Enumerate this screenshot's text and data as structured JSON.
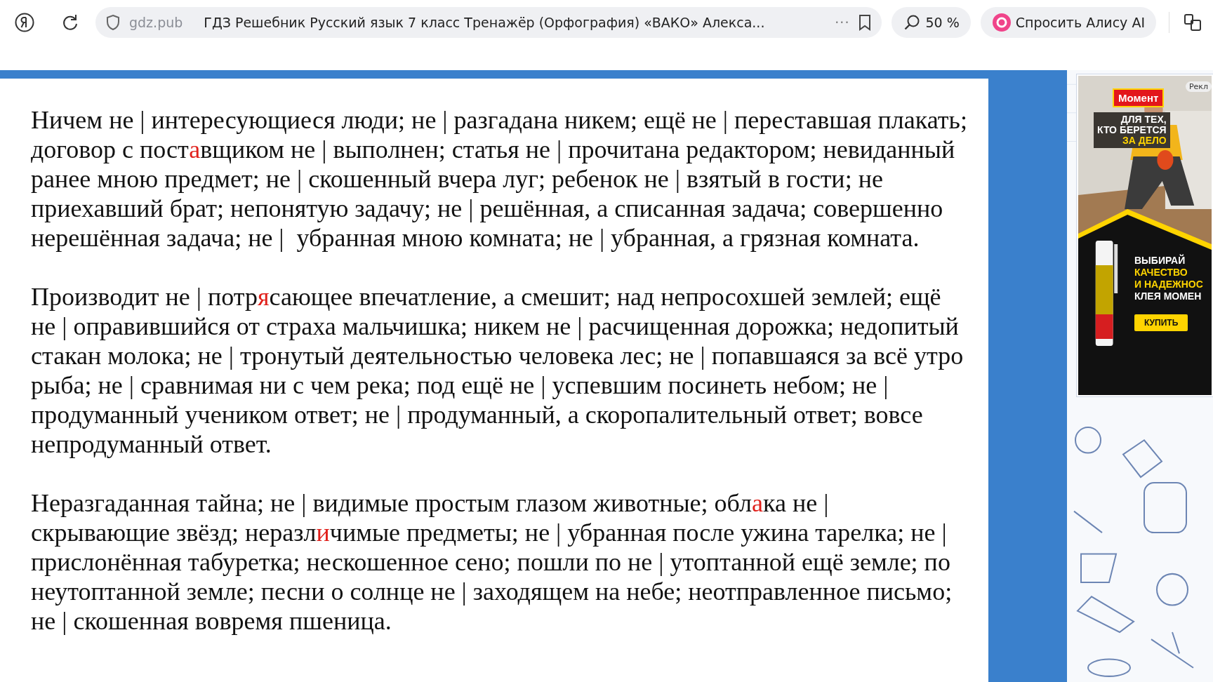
{
  "browser": {
    "site": "gdz.pub",
    "title": "ГДЗ Решебник Русский язык 7 класс Тренажёр (Орфография) «ВАКО» Алекса...",
    "menu": "···",
    "zoom": "50 %",
    "assistant": "Спросить Алису AI"
  },
  "exercises": [
    {
      "lines": [
        [
          {
            "text": "Ничем не | интересующиеся люди; не | разгадана никем; ещё не | переставшая плакать;",
            "highlighted": false
          }
        ],
        [
          {
            "text": "договор с пост",
            "highlighted": false
          },
          {
            "text": "а",
            "highlighted": true
          },
          {
            "text": "вщиком не | выполнен; статья не | прочитана редактором; невиданный",
            "highlighted": false
          }
        ],
        [
          {
            "text": "ранее мною предмет; не | скошенный вчера луг; ребенок не | взятый в гости; не",
            "highlighted": false
          }
        ],
        [
          {
            "text": "приехавший брат; непонятую задачу; не | решённая, а списанная задача; совершенно",
            "highlighted": false
          }
        ],
        [
          {
            "text": "нерешённая задача; не |  убранная мною комната; не | убранная, а грязная комната.",
            "highlighted": false
          }
        ]
      ]
    },
    {
      "lines": [
        [
          {
            "text": "Производит не | потр",
            "highlighted": false
          },
          {
            "text": "я",
            "highlighted": true
          },
          {
            "text": "сающее впечатление, а смешит; над непросохшей землей; ещё",
            "highlighted": false
          }
        ],
        [
          {
            "text": "не | оправившийся от страха мальчишка; никем не | расчищенная дорожка; недопитый",
            "highlighted": false
          }
        ],
        [
          {
            "text": "стакан молока; не | тронутый деятельностью человека лес; не | попавшаяся за всё утро",
            "highlighted": false
          }
        ],
        [
          {
            "text": "рыба; не | сравнимая ни с чем река; под ещё не | успевшим посинеть небом; не |",
            "highlighted": false
          }
        ],
        [
          {
            "text": "продуманный учеником ответ; не | продуманный, а скоропалительный ответ; вовсе",
            "highlighted": false
          }
        ],
        [
          {
            "text": "непродуманный ответ.",
            "highlighted": false
          }
        ]
      ]
    },
    {
      "lines": [
        [
          {
            "text": "Неразгаданная тайна; не | видимые простым глазом животные; обл",
            "highlighted": false
          },
          {
            "text": "а",
            "highlighted": true
          },
          {
            "text": "ка не |",
            "highlighted": false
          }
        ],
        [
          {
            "text": "скрывающие звёзд; неразл",
            "highlighted": false
          },
          {
            "text": "и",
            "highlighted": true
          },
          {
            "text": "чимые предметы; не | убранная после ужина тарелка; не |",
            "highlighted": false
          }
        ],
        [
          {
            "text": "прислонённая табуретка; нескошенное сено; пошли по не | утоптанной ещё земле; по",
            "highlighted": false
          }
        ],
        [
          {
            "text": "неутоптанной земле; песни о солнце не | заходящем на небе; неотправленное письмо;",
            "highlighted": false
          }
        ],
        [
          {
            "text": "не | скошенная вовремя пшеница.",
            "highlighted": false
          }
        ]
      ]
    }
  ],
  "ad": {
    "label": "Рекл",
    "brand": "Момент",
    "slogan": [
      {
        "text": "ДЛЯ ТЕХ,",
        "highlighted": false
      },
      {
        "text": "КТО БЕРЕТСЯ",
        "highlighted": false
      },
      {
        "text": "ЗА ДЕЛО",
        "highlighted": true
      }
    ],
    "headline": [
      {
        "text": "ВЫБИРАЙ",
        "highlighted": false
      },
      {
        "text": "КАЧЕСТВО",
        "highlighted": true
      },
      {
        "text": "И НАДЕЖНОС",
        "highlighted": true
      },
      {
        "text": "КЛЕЯ МОМЕН",
        "highlighted": false
      }
    ],
    "button": "КУПИТЬ"
  }
}
